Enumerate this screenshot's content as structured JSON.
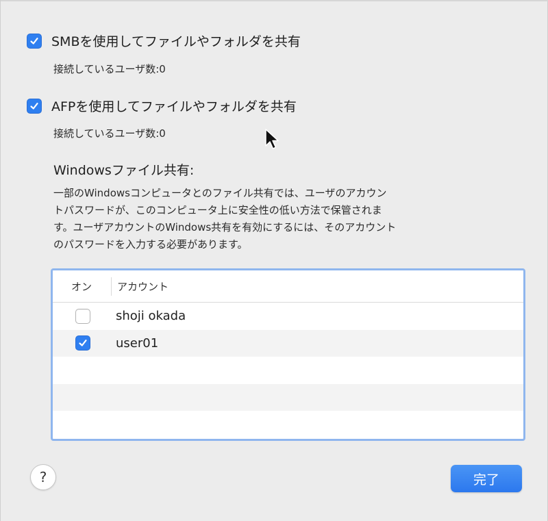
{
  "options": {
    "smb": {
      "label": "SMBを使用してファイルやフォルダを共有",
      "checked": true,
      "status": "接続しているユーザ数:0"
    },
    "afp": {
      "label": "AFPを使用してファイルやフォルダを共有",
      "checked": true,
      "status": "接続しているユーザ数:0"
    }
  },
  "windows_sharing": {
    "title": "Windowsファイル共有:",
    "description_lines": [
      "一部のWindowsコンピュータとのファイル共有では、ユーザのアカウン",
      "トパスワードが、このコンピュータ上に安全性の低い方法で保管されま",
      "す。ユーザアカウントのWindows共有を有効にするには、そのアカウント",
      "のパスワードを入力する必要があります。"
    ]
  },
  "table": {
    "col_on": "オン",
    "col_account": "アカウント",
    "rows": [
      {
        "name": "shoji okada",
        "checked": false
      },
      {
        "name": "user01",
        "checked": true
      }
    ]
  },
  "buttons": {
    "help": "?",
    "done": "完了"
  },
  "colors": {
    "accent": "#2f7ff0",
    "background": "#ececec",
    "table_focus_ring": "#8fb6ee"
  }
}
